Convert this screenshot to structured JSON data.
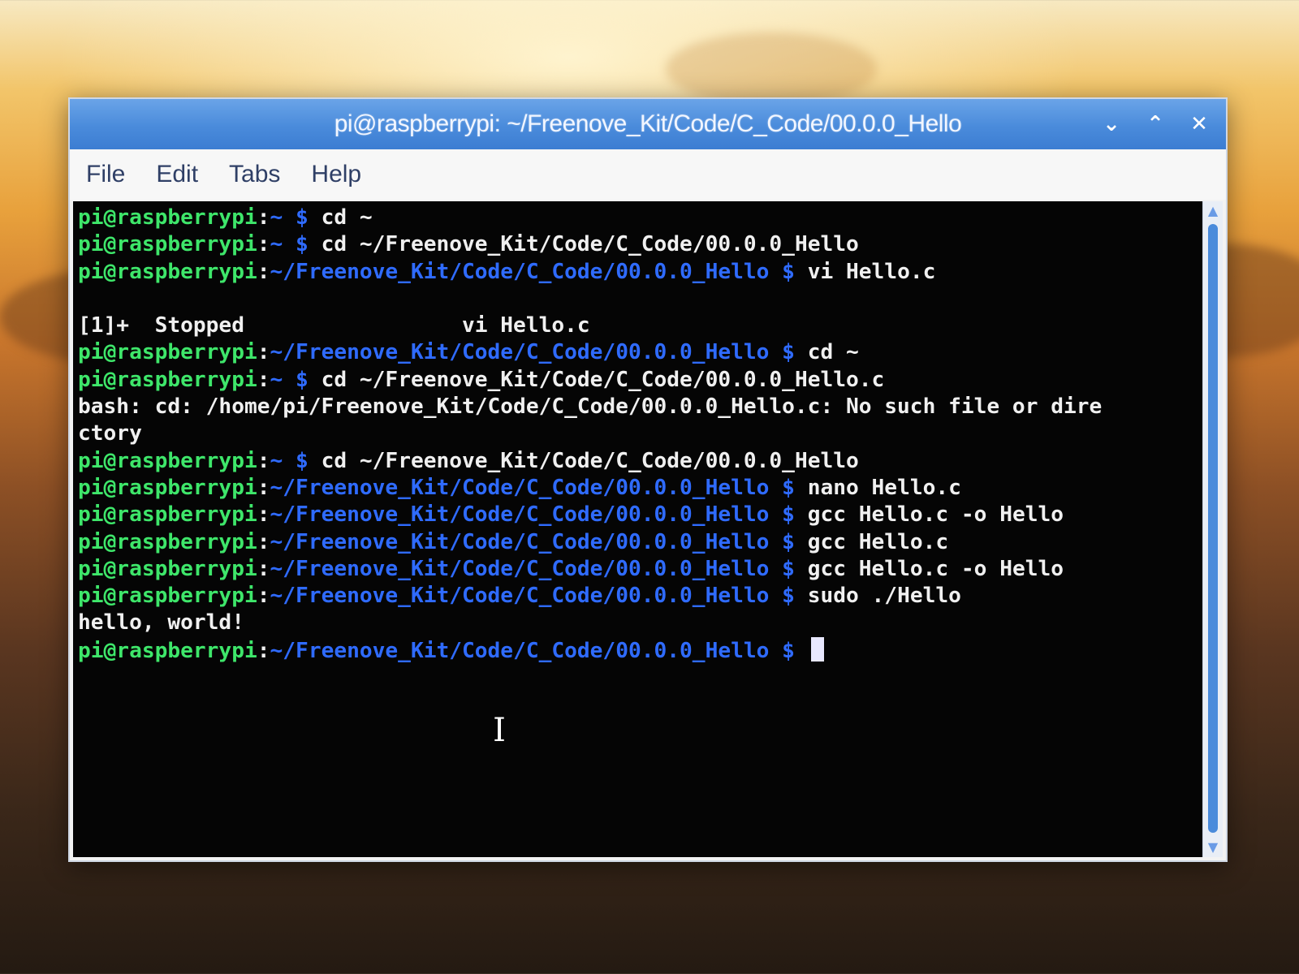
{
  "window": {
    "title": "pi@raspberrypi: ~/Freenove_Kit/Code/C_Code/00.0.0_Hello",
    "controls": [
      {
        "name": "minimize-button",
        "icon": "chevron-down-icon",
        "glyph": "⌄"
      },
      {
        "name": "maximize-button",
        "icon": "chevron-up-icon",
        "glyph": "⌃"
      },
      {
        "name": "close-button",
        "icon": "close-icon",
        "glyph": "✕"
      }
    ]
  },
  "menu": {
    "file": "File",
    "edit": "Edit",
    "tabs": "Tabs",
    "help": "Help"
  },
  "terminal": {
    "colors": {
      "user": "#3ee66a",
      "path": "#2f6bff",
      "text": "#f0f0f0"
    },
    "lines": [
      {
        "user": "pi@raspberrypi",
        "colon": ":",
        "path": "~ $",
        "text": " cd ~"
      },
      {
        "user": "pi@raspberrypi",
        "colon": ":",
        "path": "~ $",
        "text": " cd ~/Freenove_Kit/Code/C_Code/00.0.0_Hello"
      },
      {
        "user": "pi@raspberrypi",
        "colon": ":",
        "path": "~/Freenove_Kit/Code/C_Code/00.0.0_Hello $",
        "text": " vi Hello.c"
      },
      {
        "user": "",
        "colon": "",
        "path": "",
        "text": ""
      },
      {
        "user": "",
        "colon": "",
        "path": "",
        "text": "[1]+  Stopped                 vi Hello.c"
      },
      {
        "user": "pi@raspberrypi",
        "colon": ":",
        "path": "~/Freenove_Kit/Code/C_Code/00.0.0_Hello $",
        "text": " cd ~"
      },
      {
        "user": "pi@raspberrypi",
        "colon": ":",
        "path": "~ $",
        "text": " cd ~/Freenove_Kit/Code/C_Code/00.0.0_Hello.c"
      },
      {
        "user": "",
        "colon": "",
        "path": "",
        "text": "bash: cd: /home/pi/Freenove_Kit/Code/C_Code/00.0.0_Hello.c: No such file or dire"
      },
      {
        "user": "",
        "colon": "",
        "path": "",
        "text": "ctory"
      },
      {
        "user": "pi@raspberrypi",
        "colon": ":",
        "path": "~ $",
        "text": " cd ~/Freenove_Kit/Code/C_Code/00.0.0_Hello"
      },
      {
        "user": "pi@raspberrypi",
        "colon": ":",
        "path": "~/Freenove_Kit/Code/C_Code/00.0.0_Hello $",
        "text": " nano Hello.c"
      },
      {
        "user": "pi@raspberrypi",
        "colon": ":",
        "path": "~/Freenove_Kit/Code/C_Code/00.0.0_Hello $",
        "text": " gcc Hello.c -o Hello"
      },
      {
        "user": "pi@raspberrypi",
        "colon": ":",
        "path": "~/Freenove_Kit/Code/C_Code/00.0.0_Hello $",
        "text": " gcc Hello.c"
      },
      {
        "user": "pi@raspberrypi",
        "colon": ":",
        "path": "~/Freenove_Kit/Code/C_Code/00.0.0_Hello $",
        "text": " gcc Hello.c -o Hello"
      },
      {
        "user": "pi@raspberrypi",
        "colon": ":",
        "path": "~/Freenove_Kit/Code/C_Code/00.0.0_Hello $",
        "text": " sudo ./Hello"
      },
      {
        "user": "",
        "colon": "",
        "path": "",
        "text": "hello, world!"
      },
      {
        "user": "pi@raspberrypi",
        "colon": ":",
        "path": "~/Freenove_Kit/Code/C_Code/00.0.0_Hello $",
        "text": " ",
        "cursor": true
      }
    ]
  },
  "scrollbar": {
    "up_icon": "scroll-up-icon",
    "down_icon": "scroll-down-icon",
    "up_glyph": "▲",
    "down_glyph": "▼"
  }
}
